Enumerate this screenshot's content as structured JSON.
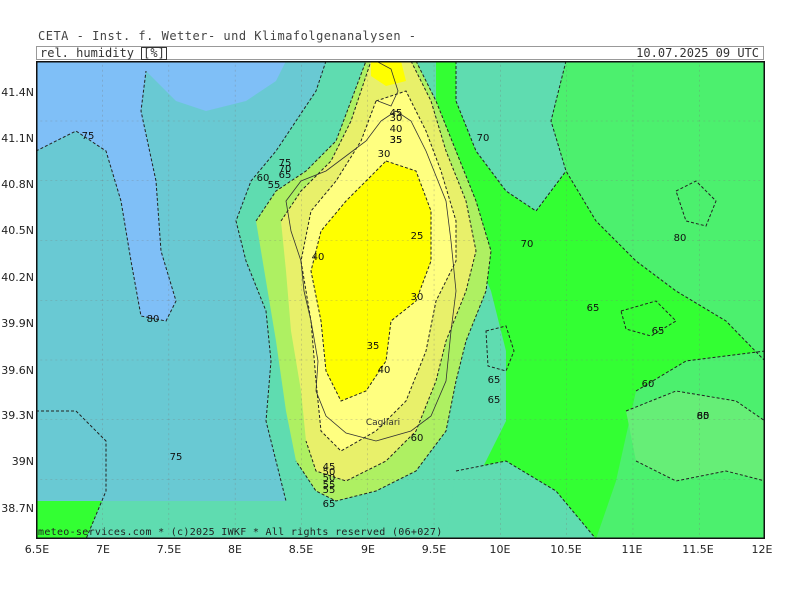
{
  "header": {
    "title": "CETA - Inst. f. Wetter- und Klimafolgenanalysen -",
    "parameter_label": "rel. humidity",
    "parameter_unit": "[%]",
    "valid_time": "10.07.2025 09 UTC"
  },
  "map": {
    "lat_labels": [
      "41.4N",
      "41.1N",
      "40.8N",
      "40.5N",
      "40.2N",
      "39.9N",
      "39.6N",
      "39.3N",
      "39N",
      "38.7N"
    ],
    "lon_labels": [
      "6.5E",
      "7E",
      "7.5E",
      "8E",
      "8.5E",
      "9E",
      "9.5E",
      "10E",
      "10.5E",
      "11E",
      "11.5E",
      "12E"
    ],
    "contour_labels": [
      "75",
      "70",
      "80",
      "70",
      "80",
      "65",
      "65",
      "65",
      "65",
      "60",
      "65",
      "80",
      "75",
      "40",
      "30",
      "25",
      "30",
      "35",
      "40",
      "60",
      "65",
      "50",
      "45",
      "55",
      "35",
      "30",
      "40",
      "35",
      "75",
      "70",
      "65",
      "55",
      "60",
      "45",
      "55",
      "50"
    ],
    "place_label": "Cagliari",
    "colors": {
      "very_dry": "#ffff00",
      "dry": "#ffff80",
      "semi_dry": "#e8f06a",
      "medium": "#aef062",
      "green_bright": "#33ff33",
      "green": "#4cf06e",
      "green_light": "#66ee77",
      "teal": "#5fdcb0",
      "blue_grey": "#69c9d3",
      "blue": "#7fbff7",
      "contour": "#222222"
    }
  },
  "footer": {
    "copyright": "meteo-services.com * (c)2025 IWKF * All rights reserved (06+027)"
  }
}
